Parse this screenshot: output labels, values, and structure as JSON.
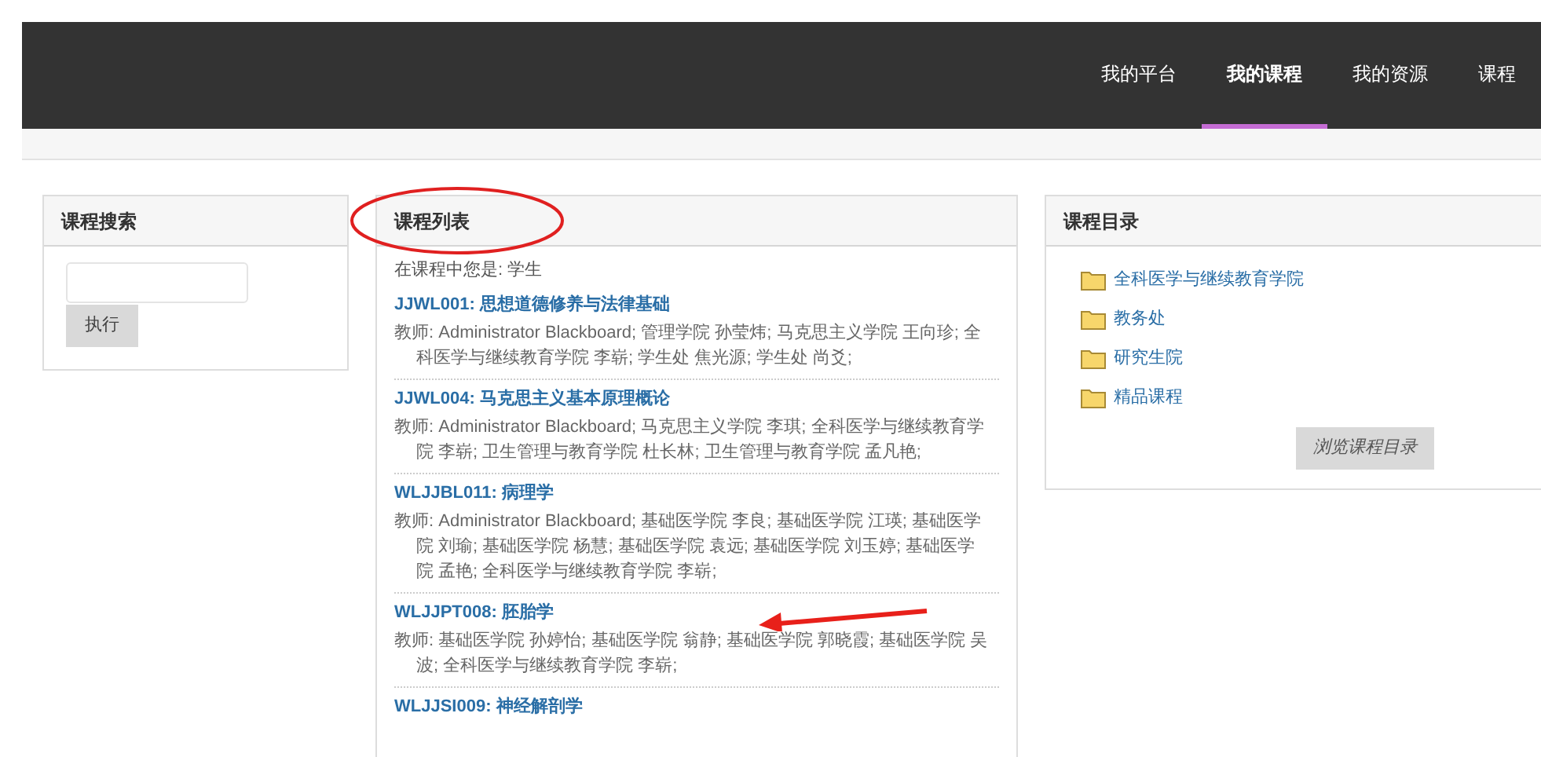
{
  "nav": [
    {
      "label": "我的平台",
      "selected": false
    },
    {
      "label": "我的课程",
      "selected": true
    },
    {
      "label": "我的资源",
      "selected": false
    },
    {
      "label": "课程",
      "selected": false
    }
  ],
  "search_panel": {
    "title": "课程搜索",
    "button": "执行"
  },
  "course_list": {
    "title": "课程列表",
    "role_line": "在课程中您是: 学生",
    "courses": [
      {
        "title": "JJWL001: 思想道德修养与法律基础",
        "teachers": "教师: Administrator Blackboard; 管理学院 孙莹炜; 马克思主义学院 王向珍; 全科医学与继续教育学院 李崭; 学生处 焦光源; 学生处 尚爻;"
      },
      {
        "title": "JJWL004: 马克思主义基本原理概论",
        "teachers": "教师: Administrator Blackboard; 马克思主义学院 李琪; 全科医学与继续教育学院 李崭; 卫生管理与教育学院 杜长林; 卫生管理与教育学院 孟凡艳;"
      },
      {
        "title": "WLJJBL011: 病理学",
        "teachers": "教师: Administrator Blackboard; 基础医学院 李良; 基础医学院 江瑛; 基础医学院 刘瑜; 基础医学院 杨慧; 基础医学院 袁远; 基础医学院 刘玉婷; 基础医学院 孟艳; 全科医学与继续教育学院 李崭;"
      },
      {
        "title": "WLJJPT008: 胚胎学",
        "teachers": "教师: 基础医学院 孙婷怡; 基础医学院 翁静; 基础医学院 郭晓霞; 基础医学院 吴波; 全科医学与继续教育学院 李崭;"
      },
      {
        "title": "WLJJSI009: 神经解剖学"
      }
    ]
  },
  "catalog_panel": {
    "title": "课程目录",
    "folders": [
      "全科医学与继续教育学院",
      "教务处",
      "研究生院",
      "精品课程"
    ],
    "button": "浏览课程目录"
  }
}
